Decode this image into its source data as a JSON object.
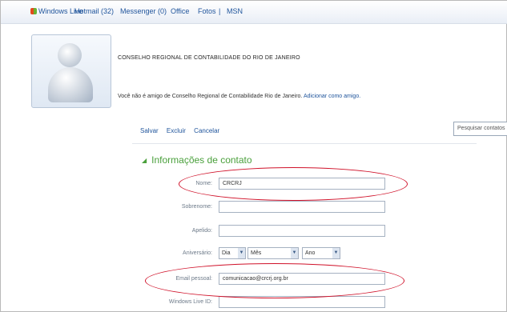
{
  "nav": {
    "logo": "Windows Live",
    "items": [
      "Hotmail (32)",
      "Messenger (0)",
      "Office",
      "Fotos",
      "MSN"
    ],
    "separator": "|"
  },
  "contact": {
    "name": "CONSELHO REGIONAL DE CONTABILIDADE DO RIO DE JANEIRO",
    "description": "Você não é amigo de Conselho Regional de Contabilidade Rio de Janeiro.",
    "add_friend_link": "Adicionar como amigo."
  },
  "actions": [
    "Salvar",
    "Excluir",
    "Cancelar"
  ],
  "search": {
    "placeholder": "Pesquisar contatos"
  },
  "section": {
    "title": "Informações de contato"
  },
  "form": {
    "name_label": "Nome:",
    "name_value": "CRCRJ",
    "surname_label": "Sobrenome:",
    "surname_value": "",
    "nickname_label": "Apelido:",
    "nickname_value": "",
    "birthday_label": "Aniversário:",
    "birthday_day": "Dia",
    "birthday_month": "Mês",
    "birthday_year": "Ano",
    "email_label": "Email pessoal:",
    "email_value": "comunicacao@crcrj.org.br",
    "wlid_label": "Windows Live ID:",
    "wlid_value": ""
  },
  "highlight_color": "#d0122a"
}
